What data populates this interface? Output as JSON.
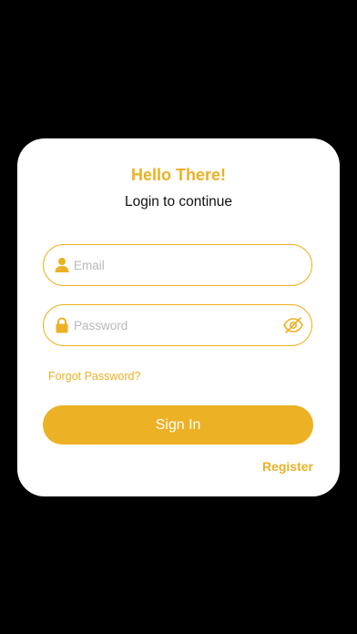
{
  "theme": {
    "accent": "#ECB124",
    "background": "#000000",
    "card": "#FFFFFF"
  },
  "card": {
    "title": "Hello There!",
    "subtitle": "Login to continue"
  },
  "email": {
    "placeholder": "Email",
    "value": "",
    "icon": "user-icon"
  },
  "password": {
    "placeholder": "Password",
    "value": "",
    "icon": "lock-icon",
    "toggle_icon": "eye-hidden-icon"
  },
  "links": {
    "forgot": "Forgot Password?",
    "register": "Register"
  },
  "buttons": {
    "signin": "Sign In"
  }
}
